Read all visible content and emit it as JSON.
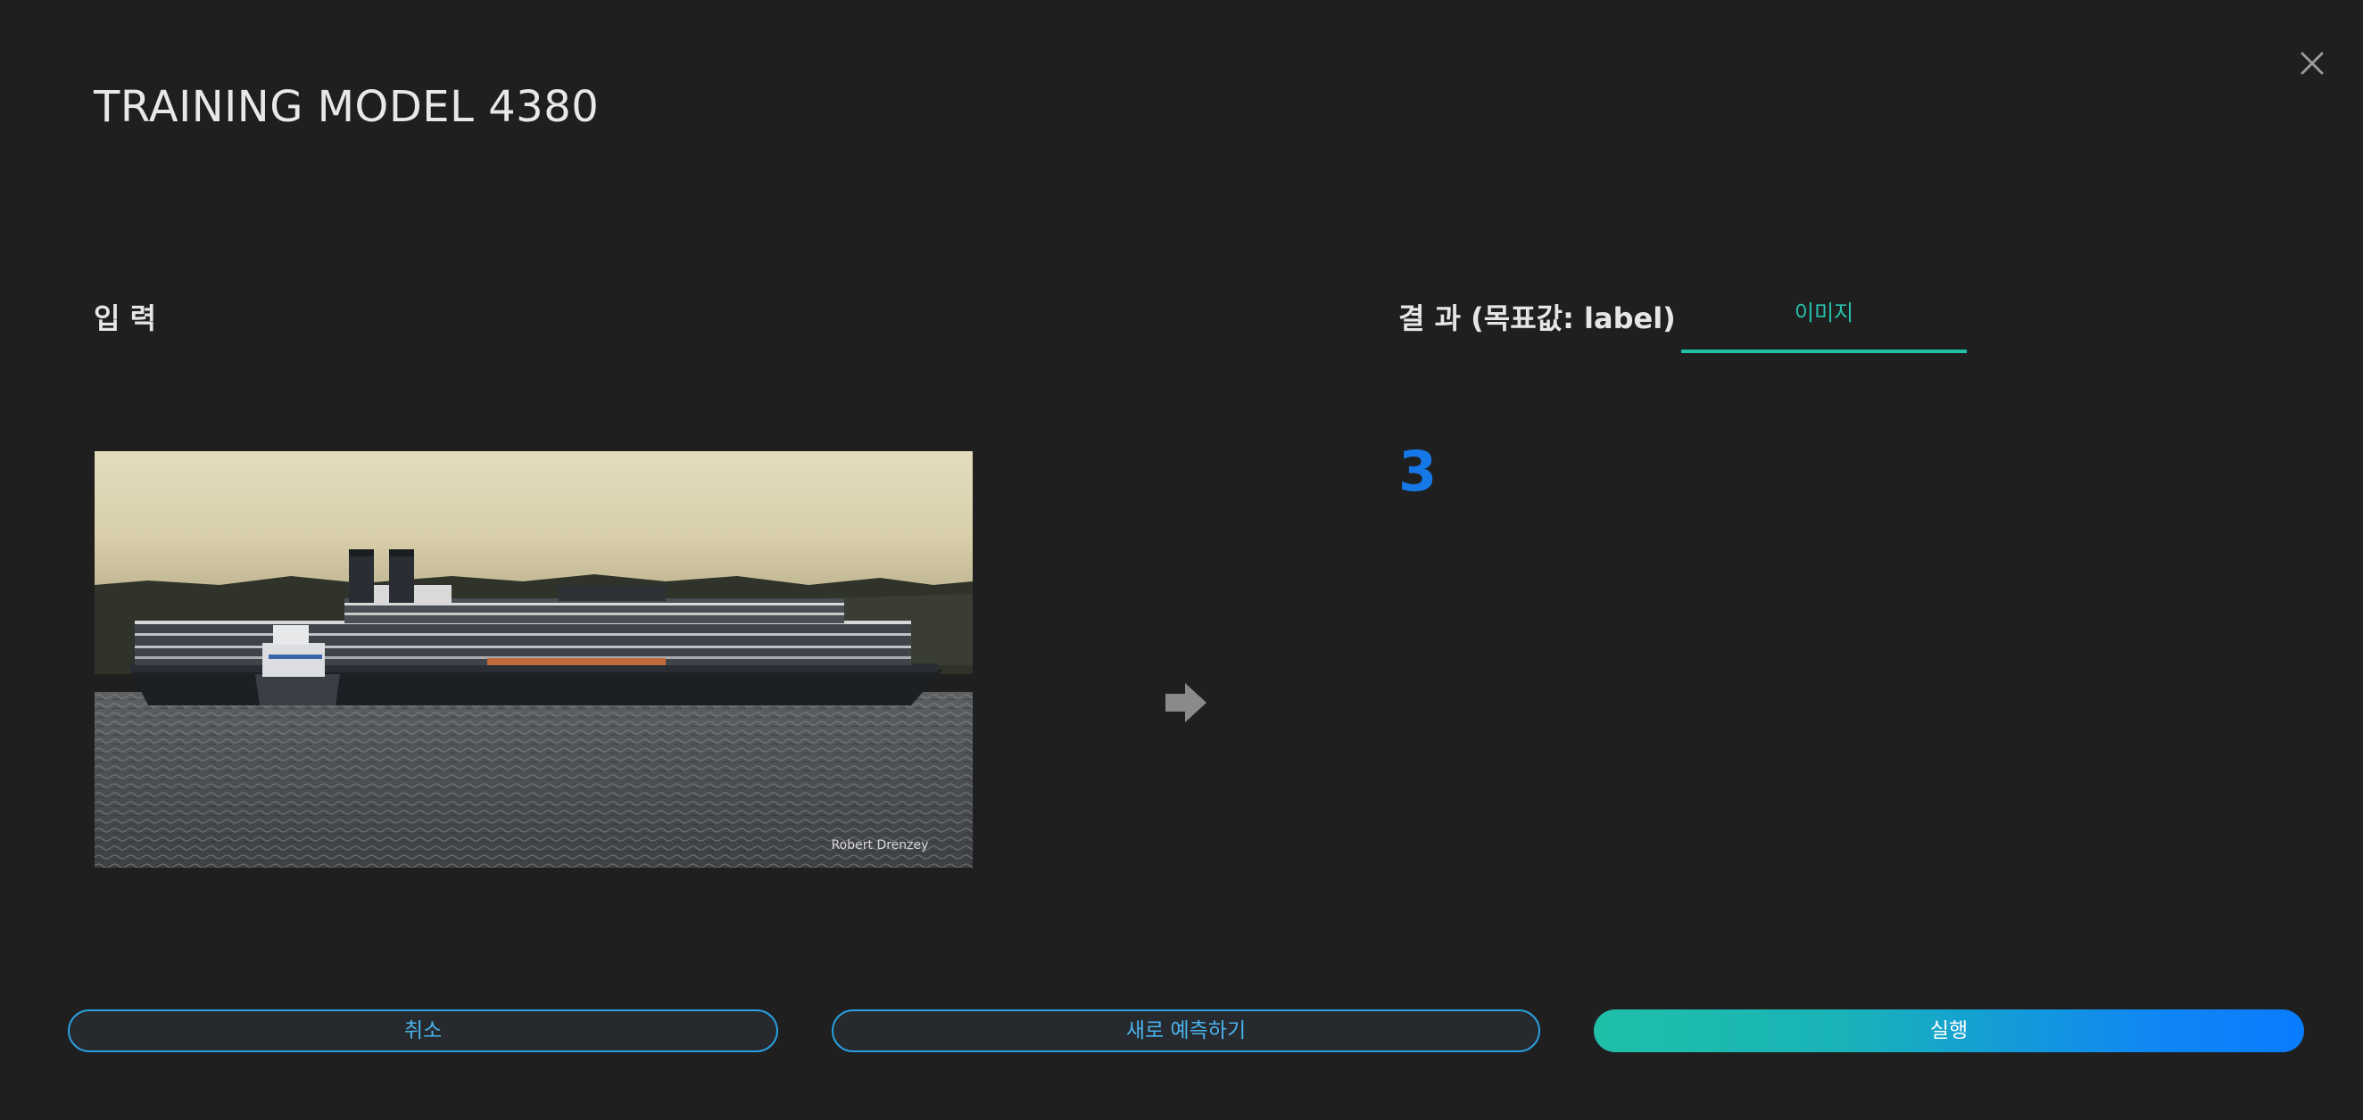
{
  "dialog": {
    "title": "TRAINING MODEL 4380"
  },
  "input": {
    "label": "입 력",
    "image_watermark": "Robert Drenzey"
  },
  "result": {
    "label": "결 과 (목표값: label)",
    "tab_label": "이미지",
    "value": "3"
  },
  "buttons": {
    "cancel_label": "취소",
    "new_predict_label": "새로 예측하기",
    "run_label": "실행"
  },
  "colors": {
    "background": "#1f1f1f",
    "accent_teal": "#1fbfa8",
    "accent_blue": "#0a7cff",
    "result_value": "#1677e6",
    "outline_button": "#2a9fe0"
  },
  "icons": {
    "close": "close-icon",
    "arrow": "arrow-right-icon"
  }
}
